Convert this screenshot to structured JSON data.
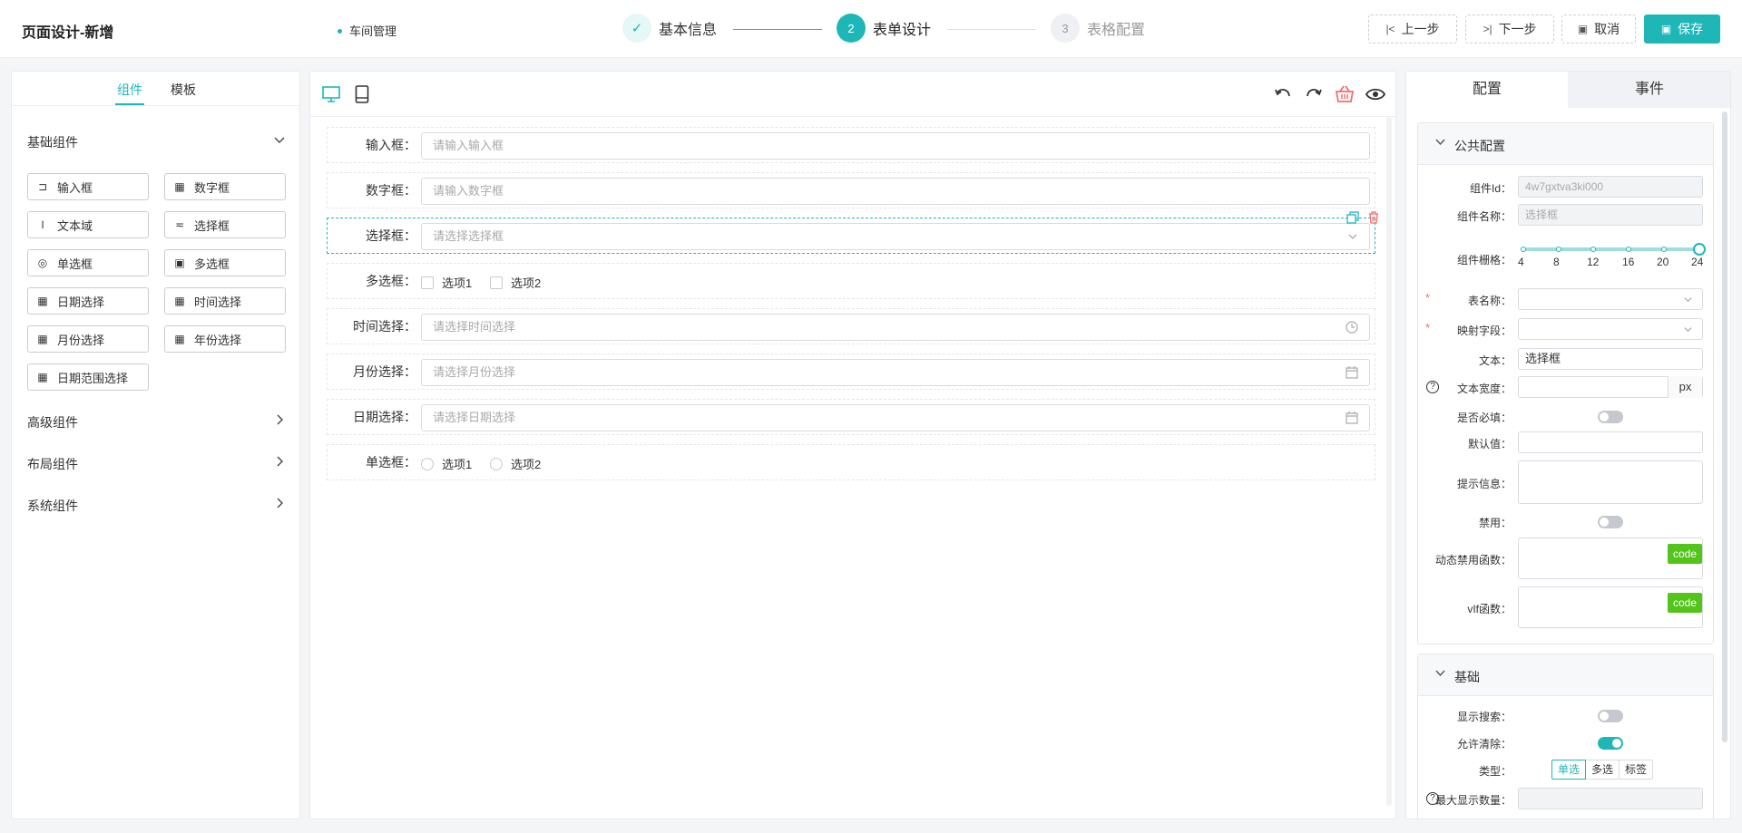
{
  "header": {
    "title": "页面设计-新增",
    "breadcrumb": "车间管理",
    "steps": [
      {
        "number": "✓",
        "label": "基本信息",
        "status": "done"
      },
      {
        "number": "2",
        "label": "表单设计",
        "status": "active"
      },
      {
        "number": "3",
        "label": "表格配置",
        "status": "pending"
      }
    ],
    "buttons": {
      "prev": "上一步",
      "next": "下一步",
      "cancel": "取消",
      "save": "保存"
    }
  },
  "left": {
    "tabs": [
      "组件",
      "模板"
    ],
    "active_tab": "组件",
    "groups": {
      "basic": "基础组件",
      "advanced": "高级组件",
      "layout": "布局组件",
      "system": "系统组件"
    },
    "components": [
      {
        "label": "输入框",
        "icon": "input-icon"
      },
      {
        "label": "数字框",
        "icon": "number-icon"
      },
      {
        "label": "文本域",
        "icon": "textarea-icon"
      },
      {
        "label": "选择框",
        "icon": "select-icon"
      },
      {
        "label": "单选框",
        "icon": "radio-icon"
      },
      {
        "label": "多选框",
        "icon": "checkbox-icon"
      },
      {
        "label": "日期选择",
        "icon": "calendar-icon"
      },
      {
        "label": "时间选择",
        "icon": "calendar-icon"
      },
      {
        "label": "月份选择",
        "icon": "calendar-icon"
      },
      {
        "label": "年份选择",
        "icon": "calendar-icon"
      },
      {
        "label": "日期范围选择",
        "icon": "calendar-icon"
      }
    ]
  },
  "canvas": {
    "fields": [
      {
        "label": "输入框：",
        "type": "input",
        "placeholder": "请输入输入框"
      },
      {
        "label": "数字框：",
        "type": "input",
        "placeholder": "请输入数字框"
      },
      {
        "label": "选择框：",
        "type": "select",
        "placeholder": "请选择选择框",
        "selected": true
      },
      {
        "label": "多选框：",
        "type": "checkbox",
        "options": [
          "选项1",
          "选项2"
        ]
      },
      {
        "label": "时间选择：",
        "type": "time",
        "placeholder": "请选择时间选择"
      },
      {
        "label": "月份选择：",
        "type": "date",
        "placeholder": "请选择月份选择"
      },
      {
        "label": "日期选择：",
        "type": "date",
        "placeholder": "请选择日期选择"
      },
      {
        "label": "单选框：",
        "type": "radio",
        "options": [
          "选项1",
          "选项2"
        ]
      }
    ]
  },
  "right": {
    "tabs": [
      "配置",
      "事件"
    ],
    "active_tab": "配置",
    "public_section": {
      "title": "公共配置",
      "component_id_label": "组件Id：",
      "component_id": "4w7gxtva3ki000",
      "component_name_label": "组件名称：",
      "component_name_placeholder": "选择框",
      "grid_label": "组件栅格：",
      "grid_ticks": [
        "4",
        "8",
        "12",
        "16",
        "20",
        "24"
      ],
      "grid_value": 24,
      "table_name_label": "表名称：",
      "mapping_field_label": "映射字段：",
      "text_label": "文本：",
      "text_value": "选择框",
      "text_width_label": "文本宽度：",
      "text_width_unit": "px",
      "required_label": "是否必填：",
      "required": false,
      "default_label": "默认值：",
      "hint_label": "提示信息：",
      "disabled_label": "禁用：",
      "disabled": false,
      "dynamic_disable_label": "动态禁用函数：",
      "vif_label": "vIf函数：",
      "code_label": "code"
    },
    "basic_section": {
      "title": "基础",
      "show_search_label": "显示搜索：",
      "show_search": false,
      "allow_clear_label": "允许清除：",
      "allow_clear": true,
      "type_label": "类型：",
      "type_options": [
        "单选",
        "多选",
        "标签"
      ],
      "type_selected": "单选",
      "max_display_label": "最大显示数量："
    }
  },
  "colors": {
    "accent": "#1fb6b8",
    "code_button": "#52c41a",
    "danger": "#f56c6c"
  }
}
